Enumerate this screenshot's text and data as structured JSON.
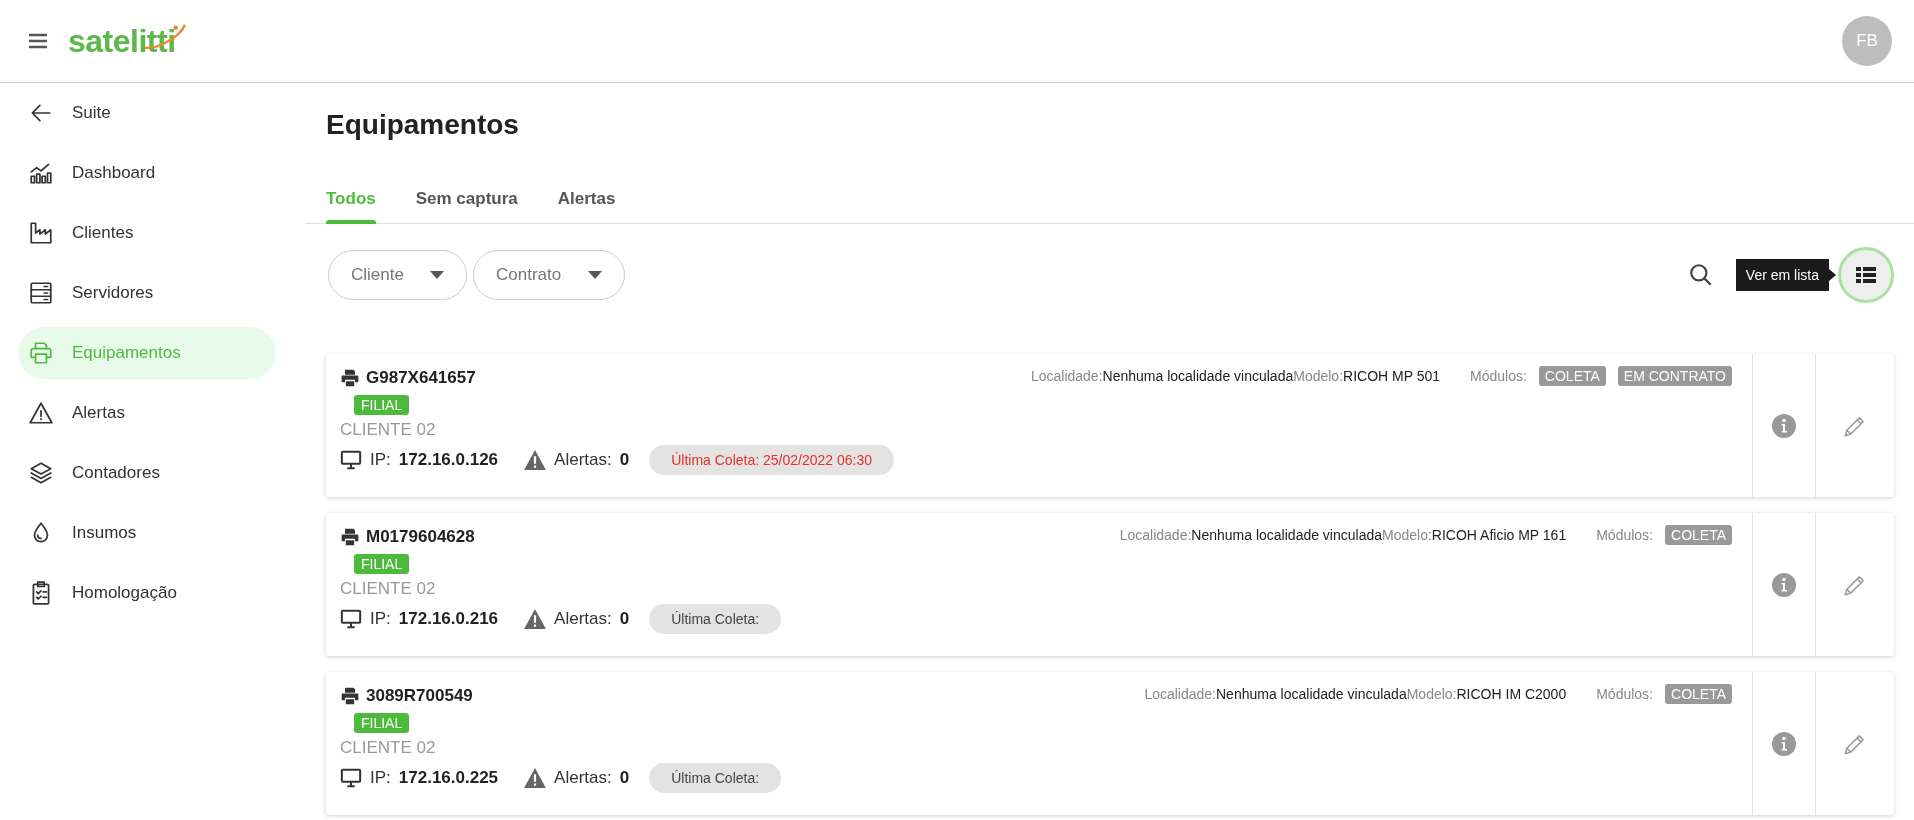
{
  "header": {
    "logo": "satelitti",
    "avatar": "FB"
  },
  "sidebar": {
    "items": [
      {
        "label": "Suite",
        "selected": false
      },
      {
        "label": "Dashboard",
        "selected": false
      },
      {
        "label": "Clientes",
        "selected": false
      },
      {
        "label": "Servidores",
        "selected": false
      },
      {
        "label": "Equipamentos",
        "selected": true
      },
      {
        "label": "Alertas",
        "selected": false
      },
      {
        "label": "Contadores",
        "selected": false
      },
      {
        "label": "Insumos",
        "selected": false
      },
      {
        "label": "Homologação",
        "selected": false
      }
    ]
  },
  "page": {
    "title": "Equipamentos"
  },
  "tabs": [
    {
      "label": "Todos",
      "selected": true
    },
    {
      "label": "Sem captura",
      "selected": false
    },
    {
      "label": "Alertas",
      "selected": false
    }
  ],
  "filters": [
    {
      "label": "Cliente"
    },
    {
      "label": "Contrato"
    }
  ],
  "view_toggle": {
    "tooltip": "Ver em lista"
  },
  "equipment": [
    {
      "serial": "G987X641657",
      "tag": "FILIAL",
      "client": "CLIENTE 02",
      "ip_label": "IP:",
      "ip": "172.16.0.126",
      "alerts_label": "Alertas:",
      "alerts": "0",
      "last_capture": {
        "text": "Última Coleta: 25/02/2022 06:30",
        "overdue": true
      },
      "location_label": "Localidade:",
      "location": "Nenhuma localidade vinculada",
      "model_label": "Modelo:",
      "model": "RICOH MP 501",
      "modules_label": "Módulos:",
      "modules": [
        "COLETA",
        "EM CONTRATO"
      ]
    },
    {
      "serial": "M0179604628",
      "tag": "FILIAL",
      "client": "CLIENTE 02",
      "ip_label": "IP:",
      "ip": "172.16.0.216",
      "alerts_label": "Alertas:",
      "alerts": "0",
      "last_capture": {
        "text": "Última Coleta:",
        "overdue": false
      },
      "location_label": "Localidade:",
      "location": "Nenhuma localidade vinculada",
      "model_label": "Modelo:",
      "model": "RICOH Aficio MP 161",
      "modules_label": "Módulos:",
      "modules": [
        "COLETA"
      ]
    },
    {
      "serial": "3089R700549",
      "tag": "FILIAL",
      "client": "CLIENTE 02",
      "ip_label": "IP:",
      "ip": "172.16.0.225",
      "alerts_label": "Alertas:",
      "alerts": "0",
      "last_capture": {
        "text": "Última Coleta:",
        "overdue": false
      },
      "location_label": "Localidade:",
      "location": "Nenhuma localidade vinculada",
      "model_label": "Modelo:",
      "model": "RICOH IM C2000",
      "modules_label": "Módulos:",
      "modules": [
        "COLETA"
      ]
    }
  ]
}
